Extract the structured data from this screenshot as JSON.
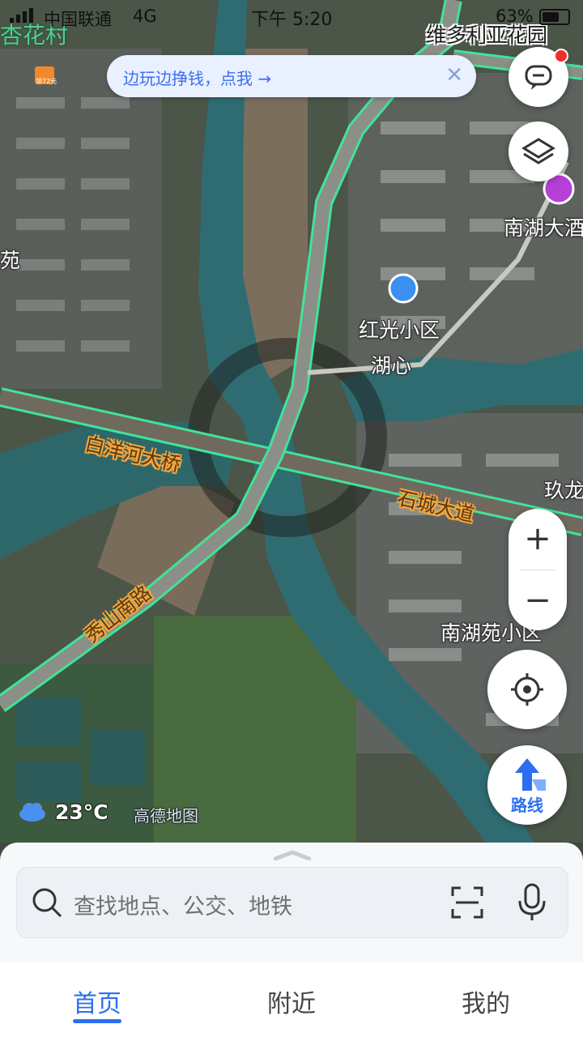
{
  "status_bar": {
    "carrier": "中国联通",
    "network": "4G",
    "time": "下午 5:20",
    "battery": "63%"
  },
  "banner": {
    "text": "边玩边挣钱，点我 →",
    "close": "✕"
  },
  "map": {
    "labels": {
      "xinghua": "杏花村",
      "victoria": "维多利亚花园",
      "nanhu_hotel": "南湖大酒",
      "yuan": "苑",
      "hongguang": "红光小区",
      "huxin": "湖心",
      "baiyanghe": "白洋河大桥",
      "shicheng": "石城大道",
      "jiulong": "玖龙",
      "xiushan": "秀山南路",
      "nanhuyuan": "南湖苑小区",
      "small_poi": "领72元"
    },
    "colors": {
      "road_outline": "#41e39a",
      "water": "#2f6c71",
      "accent": "#2c6ef2"
    }
  },
  "weather": {
    "temperature": "23°C",
    "icon": "cloud-icon"
  },
  "logo": "高德地图",
  "controls": {
    "zoom_in": "+",
    "zoom_out": "−",
    "route_label": "路线"
  },
  "search": {
    "placeholder": "查找地点、公交、地铁"
  },
  "tabs": [
    {
      "label": "首页",
      "active": true
    },
    {
      "label": "附近",
      "active": false
    },
    {
      "label": "我的",
      "active": false
    }
  ]
}
